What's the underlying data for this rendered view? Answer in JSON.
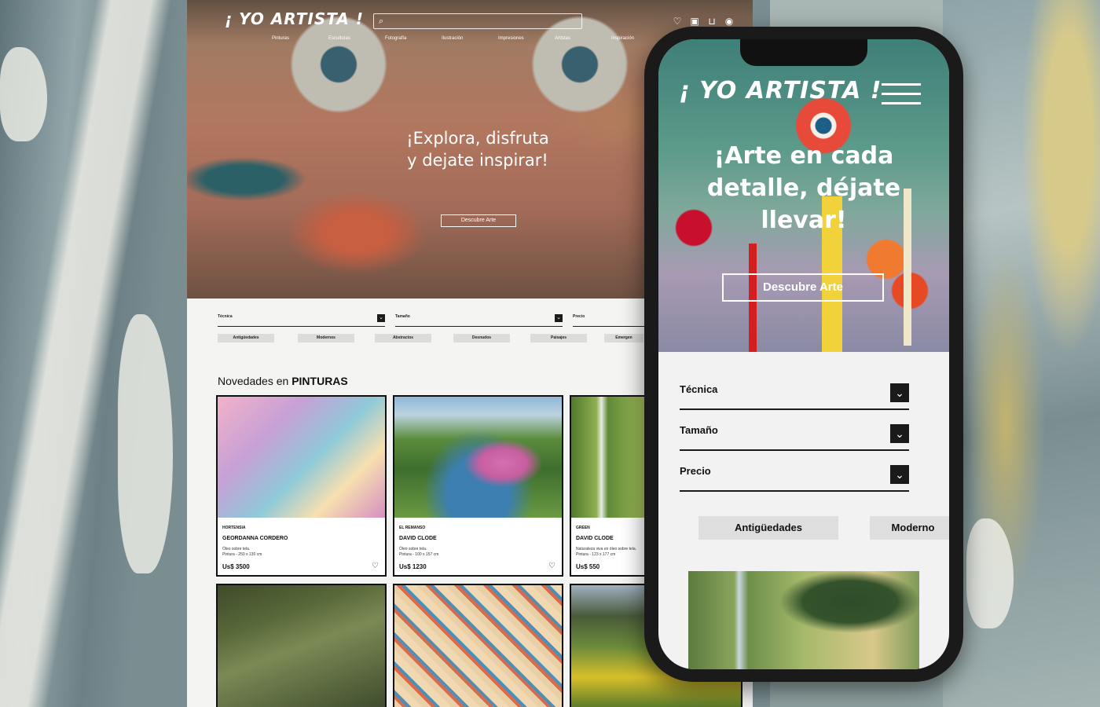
{
  "desktop": {
    "logo": "¡ YO ARTISTA !",
    "search": {
      "placeholder": ""
    },
    "header_icons": [
      "heart-icon",
      "gift-icon",
      "cart-icon",
      "user-icon"
    ],
    "nav": [
      "Pinturas",
      "Esculturas",
      "Fotografía",
      "Ilustración",
      "Impresiones",
      "Artistas",
      "Inspiración"
    ],
    "hero": {
      "title_line1": "¡Explora, disfruta",
      "title_line2": "y dejate inspirar!",
      "button": "Descubre Arte"
    },
    "filters": [
      "Técnica",
      "Tamaño",
      "Precio"
    ],
    "chips": [
      "Antigüedades",
      "Modernos",
      "Abstractos",
      "Desnudos",
      "Paisajes",
      "Emergen"
    ],
    "section": {
      "prefix": "Novedades en",
      "category": "PINTURAS"
    },
    "cards": [
      {
        "title": "HORTENSIA",
        "artist": "GEORDANNA CORDERO",
        "desc1": "Óleo sobre tela.",
        "desc2": "Pintura - 250 x 130 cm",
        "price": "Us$ 3500"
      },
      {
        "title": "EL REMANSO",
        "artist": "DAVID CLODE",
        "desc1": "Óleo sobre tela.",
        "desc2": "Pintura - 100 x 157 cm",
        "price": "Us$ 1230"
      },
      {
        "title": "GREEN",
        "artist": "DAVID CLODE",
        "desc1": "Naturaleza viva en óleo sobre tela.",
        "desc2": "Pintura - 123 x 177 cm",
        "price": "Us$ 550"
      }
    ]
  },
  "mobile": {
    "logo": "¡ YO ARTISTA !",
    "hero": {
      "title_line1": "¡Arte en cada",
      "title_line2": "detalle, déjate",
      "title_line3": "llevar!",
      "button": "Descubre Arte"
    },
    "filters": [
      "Técnica",
      "Tamaño",
      "Precio"
    ],
    "chips": [
      "Antigüedades",
      "Moderno"
    ]
  },
  "colors": {
    "ink": "#111111",
    "chip": "#dedede",
    "page": "#f4f4f2"
  }
}
